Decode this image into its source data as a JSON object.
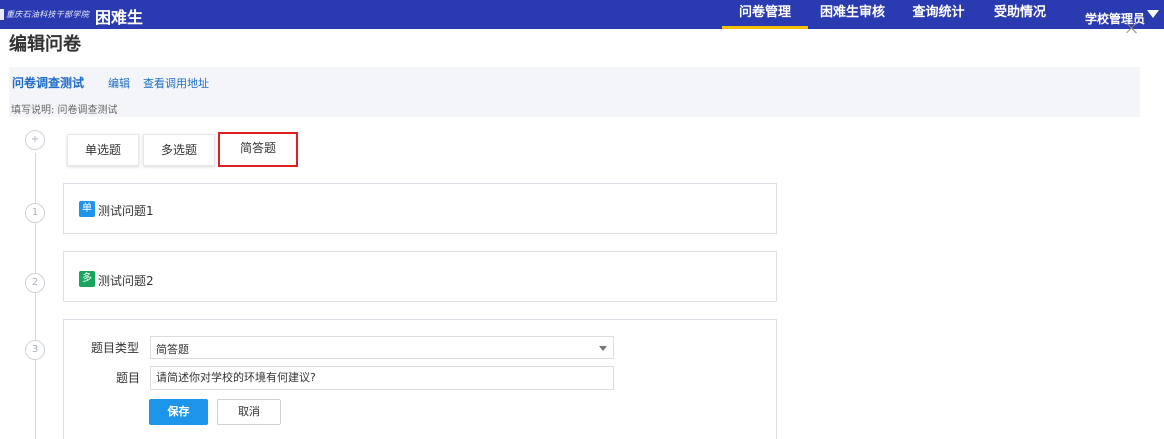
{
  "topbar": {
    "logo_text": "重庆石油科技干部学院",
    "app_title": "困难生",
    "nav": [
      {
        "label": "问卷管理",
        "active": true
      },
      {
        "label": "困难生审核",
        "active": false
      },
      {
        "label": "查询统计",
        "active": false
      },
      {
        "label": "受助情况",
        "active": false
      }
    ],
    "user_label": "学校管理员"
  },
  "dialog": {
    "title": "编辑问卷",
    "close_icon": "close-icon"
  },
  "survey": {
    "title": "问卷调查测试",
    "edit_link": "编辑",
    "view_url_link": "查看调用地址",
    "description": "填写说明:  问卷调查测试"
  },
  "timeline": {
    "add_icon": "+",
    "steps": [
      "1",
      "2",
      "3"
    ]
  },
  "question_types": {
    "single": "单选题",
    "multiple": "多选题",
    "short": "简答题",
    "selected": "简答题"
  },
  "questions": [
    {
      "badge": "单",
      "badge_color": "#1d96ea",
      "text": "测试问题1"
    },
    {
      "badge": "多",
      "badge_color": "#17a45c",
      "text": "测试问题2"
    }
  ],
  "edit_form": {
    "type_label": "题目类型",
    "type_value": "简答题",
    "question_label": "题目",
    "question_value": "请简述你对学校的环境有何建议?",
    "save_label": "保存",
    "cancel_label": "取消"
  },
  "colors": {
    "topbar": "#2a3ab1",
    "nav_active_underline": "#f5c000",
    "link": "#1f6dc9",
    "primary_button": "#1d96ea",
    "selected_outline": "#e02020"
  }
}
